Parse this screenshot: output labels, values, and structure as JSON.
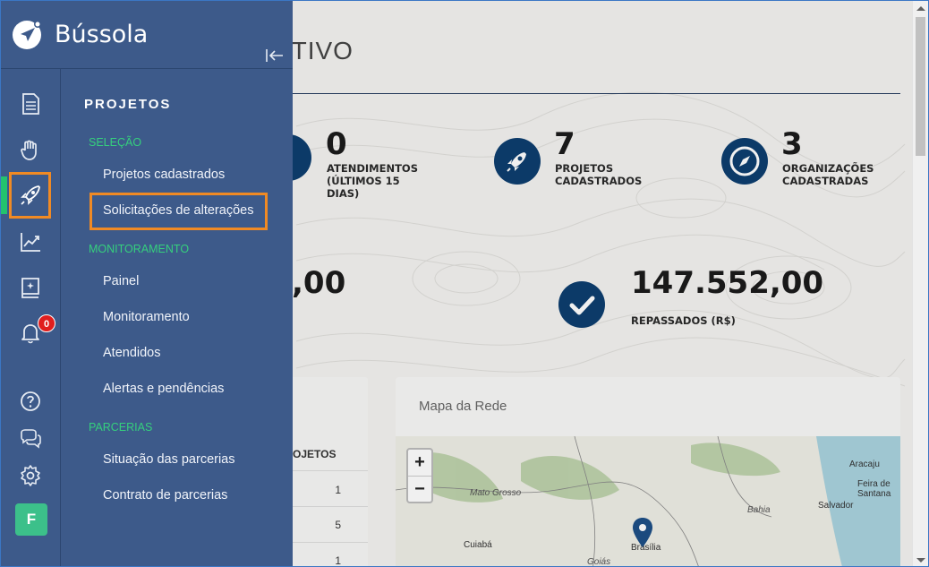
{
  "app": {
    "name": "Bússola"
  },
  "dashboard": {
    "title": "ATIVO",
    "stats": [
      {
        "value": "0",
        "label": "ATENDIMENTOS (ÚLTIMOS 15 DIAS)"
      },
      {
        "value": "7",
        "label": "PROJETOS CADASTRADOS"
      },
      {
        "value": "3",
        "label": "ORGANIZAÇÕES CADASTRADAS"
      },
      {
        "value": ",00",
        "label": ""
      },
      {
        "value": "147.552,00",
        "label": "REPASSADOS (R$)"
      }
    ],
    "table": {
      "header": "OJETOS",
      "rows": [
        "1",
        "5",
        "1"
      ]
    },
    "map": {
      "title": "Mapa da Rede",
      "zoom_in": "+",
      "zoom_out": "−",
      "places": [
        "Aracaju",
        "Feira de Santana",
        "Salvador",
        "Mato Grosso",
        "Bahia",
        "Cuiabá",
        "Brasília",
        "Goiás"
      ]
    }
  },
  "sidebar": {
    "collapse_icon": "collapse-left-icon",
    "rail": [
      {
        "icon": "document-icon"
      },
      {
        "icon": "hand-icon"
      },
      {
        "icon": "rocket-icon",
        "active": true
      },
      {
        "icon": "chart-line-icon"
      },
      {
        "icon": "book-icon"
      },
      {
        "icon": "bell-icon",
        "badge": "0"
      },
      {
        "icon": "help-icon"
      },
      {
        "icon": "chat-icon"
      },
      {
        "icon": "gear-icon"
      }
    ],
    "avatar": "F",
    "menu": {
      "title": "PROJETOS",
      "sections": [
        {
          "label": "SELEÇÃO",
          "items": [
            "Projetos cadastrados",
            "Solicitações de alterações"
          ]
        },
        {
          "label": "MONITORAMENTO",
          "items": [
            "Painel",
            "Monitoramento",
            "Atendidos",
            "Alertas e pendências"
          ]
        },
        {
          "label": "PARCERIAS",
          "items": [
            "Situação das parcerias",
            "Contrato de parcerias"
          ]
        }
      ]
    }
  },
  "colors": {
    "sidebar_bg": "#3d5a8a",
    "accent_green": "#35d07d",
    "highlight_orange": "#f08a24",
    "stat_circle": "#0d3e6f",
    "badge_red": "#e01e1e"
  }
}
